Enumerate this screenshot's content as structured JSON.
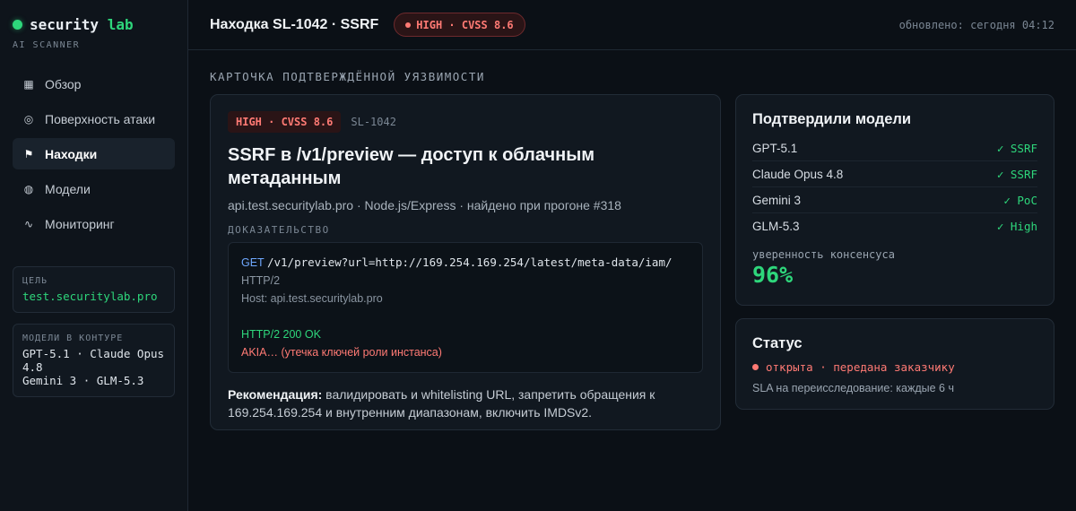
{
  "brand": {
    "name_main": "security",
    "name_accent": "lab",
    "subtitle": "AI SCANNER"
  },
  "nav": {
    "items": [
      {
        "label": "Обзор",
        "icon": "grid-icon"
      },
      {
        "label": "Поверхность атаки",
        "icon": "target-icon"
      },
      {
        "label": "Находки",
        "icon": "flag-icon"
      },
      {
        "label": "Модели",
        "icon": "globe-icon"
      },
      {
        "label": "Мониторинг",
        "icon": "pulse-icon"
      }
    ],
    "active_index": 2
  },
  "target": {
    "label": "ЦЕЛЬ",
    "value": "test.securitylab.pro"
  },
  "models_box": {
    "label": "МОДЕЛИ В КОНТУРЕ",
    "line1": "GPT-5.1 · Claude Opus 4.8",
    "line2": "Gemini 3 · GLM-5.3"
  },
  "header": {
    "title": "Находка SL-1042 · SSRF",
    "severity": "HIGH · CVSS 8.6",
    "updated": "обновлено: сегодня 04:12"
  },
  "section_title": "КАРТОЧКА ПОДТВЕРЖДЁННОЙ УЯЗВИМОСТИ",
  "finding": {
    "tag": "HIGH · CVSS 8.6",
    "id": "SL-1042",
    "title": "SSRF в /v1/preview — доступ к облачным метаданным",
    "meta": "api.test.securitylab.pro · Node.js/Express · найдено при прогоне #318",
    "evidence_label": "ДОКАЗАТЕЛЬСТВО",
    "evidence": {
      "method": "GET",
      "url": "/v1/preview?url=http://169.254.169.254/latest/meta-data/iam/",
      "protocol": "HTTP/2",
      "host": "Host: api.test.securitylab.pro",
      "response": "HTTP/2 200 OK",
      "leak": "AKIA… (утечка ключей роли инстанса)"
    },
    "recommendation_label": "Рекомендация:",
    "recommendation_text": "валидировать и whitelisting URL, запретить обращения к 169.254.169.254 и внутренним диапазонам, включить IMDSv2."
  },
  "confirmations": {
    "title": "Подтвердили модели",
    "rows": [
      {
        "model": "GPT-5.1",
        "result": "✓ SSRF"
      },
      {
        "model": "Claude Opus 4.8",
        "result": "✓ SSRF"
      },
      {
        "model": "Gemini 3",
        "result": "✓ PoC"
      },
      {
        "model": "GLM-5.3",
        "result": "✓ High"
      }
    ],
    "confidence_label": "уверенность консенсуса",
    "confidence_value": "96%"
  },
  "status": {
    "title": "Статус",
    "state": "открыта · передана заказчику",
    "sla": "SLA на переисследование: каждые 6 ч"
  },
  "colors": {
    "accent_green": "#2ed67b",
    "severity_red": "#ff7a74",
    "background": "#0b1016"
  }
}
